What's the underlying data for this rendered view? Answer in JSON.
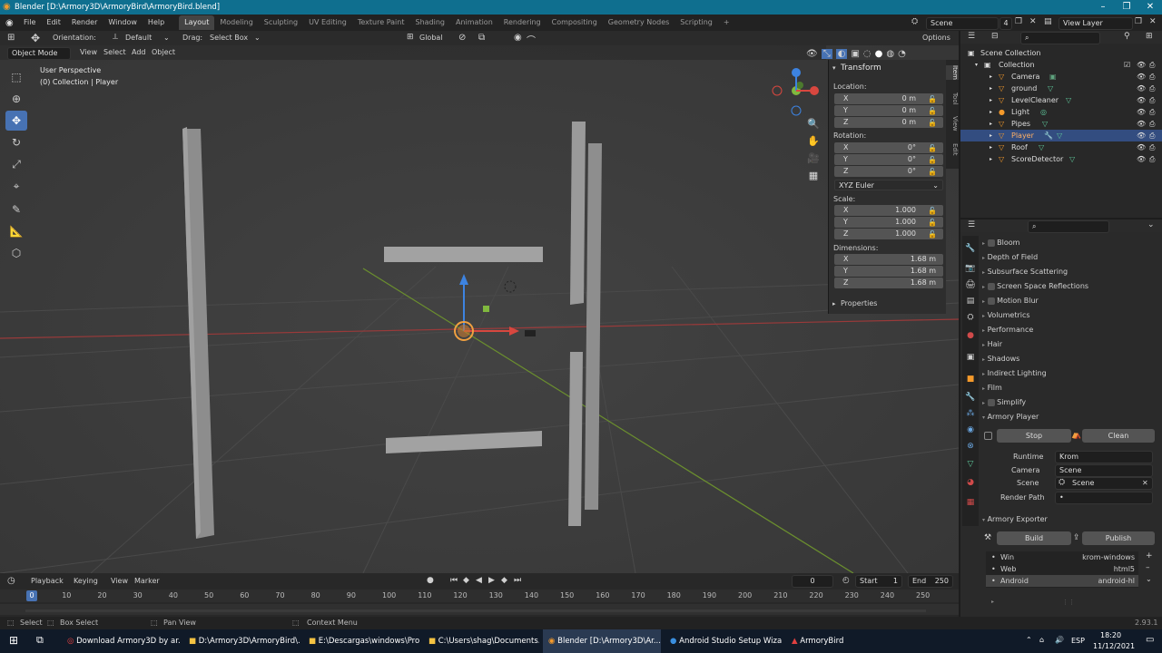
{
  "window": {
    "title": "Blender [D:\\Armory3D\\ArmoryBird\\ArmoryBird.blend]"
  },
  "menu": [
    "File",
    "Edit",
    "Render",
    "Window",
    "Help"
  ],
  "workspaces": [
    "Layout",
    "Modeling",
    "Sculpting",
    "UV Editing",
    "Texture Paint",
    "Shading",
    "Animation",
    "Rendering",
    "Compositing",
    "Geometry Nodes",
    "Scripting"
  ],
  "scene_field": "Scene",
  "view_layer_field": "View Layer",
  "tool_header": {
    "orientation_label": "Orientation:",
    "orientation_value": "Default",
    "drag_label": "Drag:",
    "drag_value": "Select Box",
    "transform_space": "Global",
    "options": "Options"
  },
  "viewport_header": {
    "mode": "Object Mode",
    "view": "View",
    "select": "Select",
    "add": "Add",
    "object": "Object"
  },
  "viewport_info": {
    "line1": "User Perspective",
    "line2": "(0) Collection | Player"
  },
  "npanel": {
    "header": "Transform",
    "location_label": "Location:",
    "location": {
      "x": "0 m",
      "y": "0 m",
      "z": "0 m"
    },
    "rotation_label": "Rotation:",
    "rotation": {
      "x": "0°",
      "y": "0°",
      "z": "0°"
    },
    "rotation_mode": "XYZ Euler",
    "scale_label": "Scale:",
    "scale": {
      "x": "1.000",
      "y": "1.000",
      "z": "1.000"
    },
    "dimensions_label": "Dimensions:",
    "dimensions": {
      "x": "1.68 m",
      "y": "1.68 m",
      "z": "1.68 m"
    },
    "axis": {
      "x": "X",
      "y": "Y",
      "z": "Z"
    },
    "properties_label": "Properties",
    "tabs": [
      "Item",
      "Tool",
      "View",
      "Edit"
    ]
  },
  "outliner": {
    "scene_collection": "Scene Collection",
    "collection": "Collection",
    "items": [
      "Camera",
      "ground",
      "LevelCleaner",
      "Light",
      "Pipes",
      "Player",
      "Roof",
      "ScoreDetector"
    ],
    "selected": "Player"
  },
  "properties": {
    "sections": [
      "Bloom",
      "Depth of Field",
      "Subsurface Scattering",
      "Screen Space Reflections",
      "Motion Blur",
      "Volumetrics",
      "Performance",
      "Hair",
      "Shadows",
      "Indirect Lighting",
      "Film",
      "Simplify",
      "Armory Player"
    ],
    "player": {
      "stop": "Stop",
      "clean": "Clean",
      "runtime_label": "Runtime",
      "runtime": "Krom",
      "camera_label": "Camera",
      "camera": "Scene",
      "scene_label": "Scene",
      "scene": "Scene",
      "render_path_label": "Render Path",
      "render_path": "•"
    },
    "exporter": {
      "header": "Armory Exporter",
      "build": "Build",
      "publish": "Publish",
      "targets": [
        {
          "name": "Win",
          "value": "krom-windows"
        },
        {
          "name": "Web",
          "value": "html5"
        },
        {
          "name": "Android",
          "value": "android-hl"
        }
      ]
    }
  },
  "timeline": {
    "playback": "Playback",
    "keying": "Keying",
    "view": "View",
    "marker": "Marker",
    "current_frame": "0",
    "start_label": "Start",
    "start": "1",
    "end_label": "End",
    "end": "250",
    "ticks": [
      "0",
      "10",
      "20",
      "30",
      "40",
      "50",
      "60",
      "70",
      "80",
      "90",
      "100",
      "110",
      "120",
      "130",
      "140",
      "150",
      "160",
      "170",
      "180",
      "190",
      "200",
      "210",
      "220",
      "230",
      "240",
      "250"
    ],
    "cursor_frame": "0"
  },
  "statusbar": {
    "select": "Select",
    "box_select": "Box Select",
    "pan_view": "Pan View",
    "context_menu": "Context Menu",
    "version": "2.93.1"
  },
  "taskbar": {
    "tasks": [
      "Download Armory3D by ar...",
      "D:\\Armory3D\\ArmoryBird\\...",
      "E:\\Descargas\\windows\\Pro...",
      "C:\\Users\\shag\\Documents...",
      "Blender [D:\\Armory3D\\Ar...",
      "Android Studio Setup Wiza...",
      "ArmoryBird"
    ],
    "lang": "ESP",
    "time": "18:20",
    "date": "11/12/2021"
  },
  "colors": {
    "accent": "#4772b3",
    "titlebar": "#0f6f8f",
    "x_axis": "#d8473f",
    "y_axis": "#80b83e",
    "z_axis": "#3d83e0",
    "selection_orange": "#f0a040"
  }
}
